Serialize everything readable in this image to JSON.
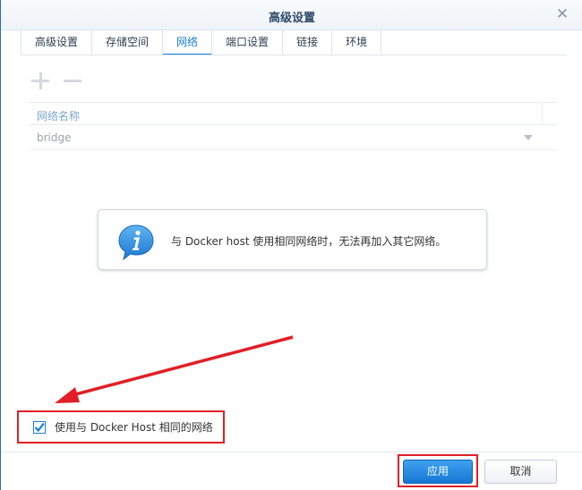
{
  "window": {
    "title": "高级设置",
    "close_glyph": "✕"
  },
  "tabs": [
    {
      "label": "高级设置",
      "active": false
    },
    {
      "label": "存储空间",
      "active": false
    },
    {
      "label": "网络",
      "active": true
    },
    {
      "label": "端口设置",
      "active": false
    },
    {
      "label": "链接",
      "active": false
    },
    {
      "label": "环境",
      "active": false
    }
  ],
  "toolbar": {
    "add_icon": "plus-icon",
    "remove_icon": "minus-icon"
  },
  "network_table": {
    "column_header": "网络名称",
    "row_value": "bridge"
  },
  "notice": {
    "icon": "info-icon",
    "message": "与 Docker host 使用相同网络时，无法再加入其它网络。"
  },
  "options": {
    "same_network_label": "使用与 Docker Host 相同的网络",
    "same_network_checked": true
  },
  "footer": {
    "apply_label": "应用",
    "cancel_label": "取消"
  },
  "colors": {
    "accent": "#1a7fd6",
    "highlight_red": "#e21f26"
  }
}
